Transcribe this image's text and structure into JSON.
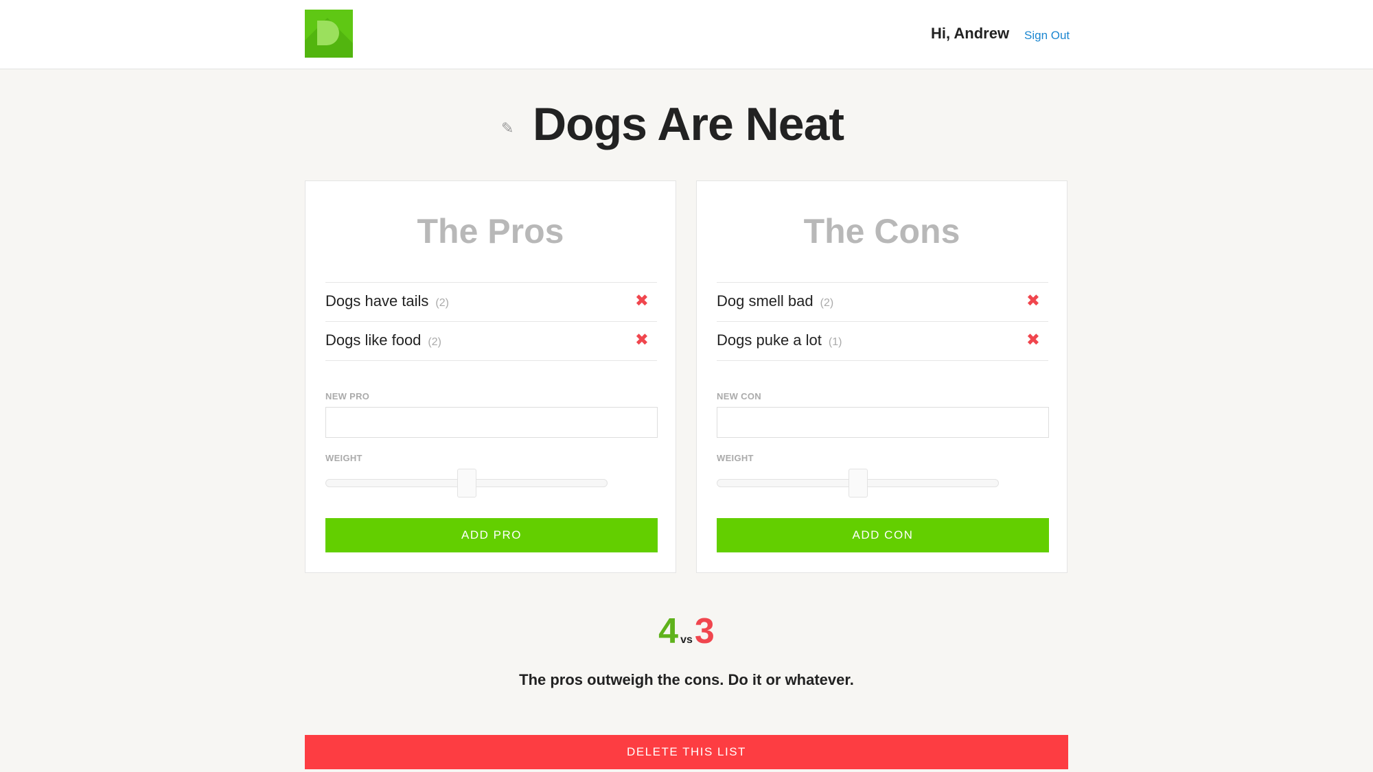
{
  "header": {
    "greeting": "Hi, Andrew",
    "sign_out": "Sign Out",
    "logo_icon": "d-logo-icon",
    "logo_color": "#5fc714"
  },
  "list": {
    "title": "Dogs Are Neat",
    "edit_icon": "pencil-icon"
  },
  "pros": {
    "heading": "The Pros",
    "items": [
      {
        "text": "Dogs have tails",
        "weight": "(2)"
      },
      {
        "text": "Dogs like food",
        "weight": "(2)"
      }
    ],
    "new_label": "NEW PRO",
    "weight_label": "WEIGHT",
    "weight_value": 0.5,
    "add_label": "ADD PRO"
  },
  "cons": {
    "heading": "The Cons",
    "items": [
      {
        "text": "Dog smell bad",
        "weight": "(2)"
      },
      {
        "text": "Dogs puke a lot",
        "weight": "(1)"
      }
    ],
    "new_label": "NEW CON",
    "weight_label": "WEIGHT",
    "weight_value": 0.5,
    "add_label": "ADD CON"
  },
  "result": {
    "pros_total": "4",
    "vs": "vs",
    "cons_total": "3",
    "verdict": "The pros outweigh the cons. Do it or whatever."
  },
  "actions": {
    "delete_label": "DELETE THIS LIST"
  },
  "colors": {
    "accent_green": "#63cf00",
    "danger_red": "#fd3d42",
    "link_blue": "#1a86d0"
  }
}
